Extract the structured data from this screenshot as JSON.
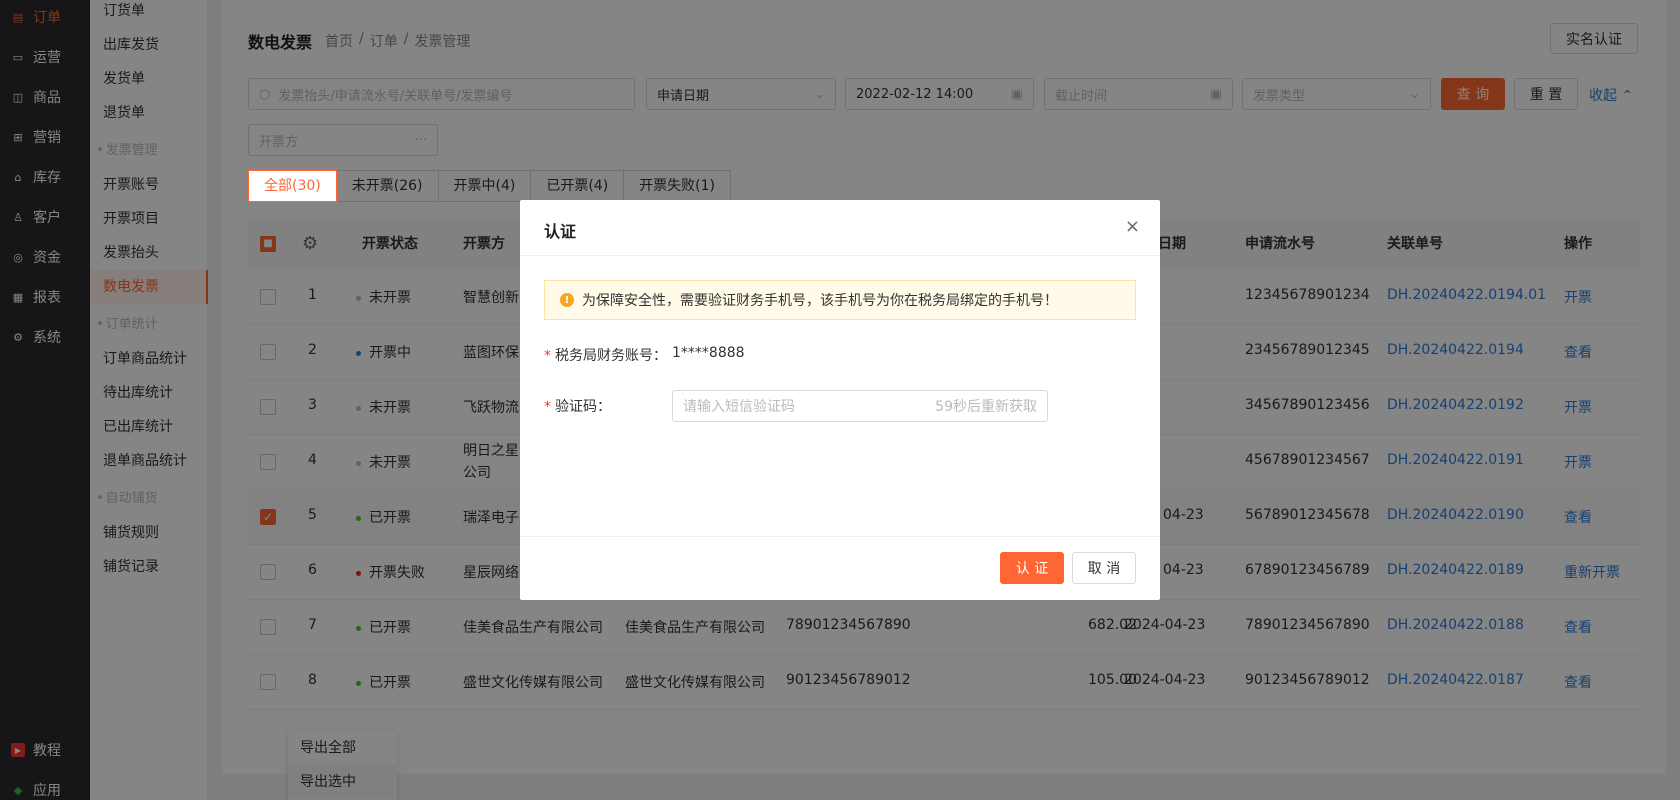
{
  "sidebar": {
    "items": [
      {
        "label": "订单",
        "icon": "order-icon",
        "active": true
      },
      {
        "label": "运营",
        "icon": "operation-icon"
      },
      {
        "label": "商品",
        "icon": "goods-icon"
      },
      {
        "label": "营销",
        "icon": "gift-icon"
      },
      {
        "label": "库存",
        "icon": "warehouse-icon"
      },
      {
        "label": "客户",
        "icon": "user-icon"
      },
      {
        "label": "资金",
        "icon": "money-icon"
      },
      {
        "label": "报表",
        "icon": "chart-icon"
      },
      {
        "label": "系统",
        "icon": "gear-icon"
      }
    ],
    "bottom": [
      {
        "label": "教程",
        "icon": "play-icon"
      },
      {
        "label": "应用",
        "icon": "app-icon"
      }
    ]
  },
  "subnav": {
    "items": [
      "订货单",
      "出库发货",
      "发货单",
      "退货单"
    ],
    "group1": "发票管理",
    "group1_items": [
      "开票账号",
      "开票项目",
      "发票抬头",
      "数电发票"
    ],
    "group2": "订单统计",
    "group2_items": [
      "订单商品统计",
      "待出库统计",
      "已出库统计",
      "退单商品统计"
    ],
    "group3": "自动铺货",
    "group3_items": [
      "铺货规则",
      "铺货记录"
    ]
  },
  "header": {
    "title": "数电发票",
    "breadcrumb": [
      "首页",
      "/",
      "订单",
      "/",
      "发票管理"
    ],
    "realname_btn": "实名认证"
  },
  "filters": {
    "search_placeholder": "发票抬头/申请流水号/关联单号/发票编号",
    "date_type": "申请日期",
    "start_time": "2022-02-12 14:00",
    "end_placeholder": "截止时间",
    "invoice_type_placeholder": "发票类型",
    "query_btn": "查 询",
    "reset_btn": "重 置",
    "collapse_btn": "收起",
    "issuer_placeholder": "开票方"
  },
  "tabs": [
    "全部(30)",
    "未开票(26)",
    "开票中(4)",
    "已开票(4)",
    "开票失败(1)"
  ],
  "table": {
    "headers": [
      "开票状态",
      "开票方",
      "日期",
      "申请流水号",
      "关联单号",
      "操作"
    ],
    "rows": [
      {
        "no": "1",
        "status": "未开票",
        "status_color": "#bbbbbb",
        "issuer": "智慧创新",
        "buyer": "",
        "tax": "",
        "amount": "",
        "date": "",
        "serial": "12345678901234",
        "ref": "DH.20240422.0194.01",
        "action": "开票",
        "checked": false
      },
      {
        "no": "2",
        "status": "开票中",
        "status_color": "#2e7dd6",
        "issuer": "蓝图环保",
        "buyer": "",
        "tax": "",
        "amount": "",
        "date": "",
        "serial": "23456789012345",
        "ref": "DH.20240422.0194",
        "action": "查看",
        "checked": false
      },
      {
        "no": "3",
        "status": "未开票",
        "status_color": "#bbbbbb",
        "issuer": "飞跃物流",
        "buyer": "",
        "tax": "",
        "amount": "",
        "date": "",
        "serial": "34567890123456",
        "ref": "DH.20240422.0192",
        "action": "开票",
        "checked": false
      },
      {
        "no": "4",
        "status": "未开票",
        "status_color": "#bbbbbb",
        "issuer": "明日之星",
        "issuer2": "公司",
        "buyer": "",
        "tax": "",
        "amount": "",
        "date": "",
        "serial": "45678901234567",
        "ref": "DH.20240422.0191",
        "action": "开票",
        "checked": false
      },
      {
        "no": "5",
        "status": "已开票",
        "status_color": "#52c41a",
        "issuer": "瑞泽电子",
        "buyer": "",
        "tax": "",
        "amount": "",
        "date": "04-23",
        "serial": "56789012345678",
        "ref": "DH.20240422.0190",
        "action": "查看",
        "checked": true
      },
      {
        "no": "6",
        "status": "开票失败",
        "status_color": "#f5222d",
        "issuer": "星辰网络",
        "buyer": "",
        "tax": "",
        "amount": "",
        "date": "04-23",
        "serial": "67890123456789",
        "ref": "DH.20240422.0189",
        "action": "重新开票",
        "checked": false
      },
      {
        "no": "7",
        "status": "已开票",
        "status_color": "#52c41a",
        "issuer": "佳美食品生产有限公司",
        "buyer": "佳美食品生产有限公司",
        "tax": "78901234567890",
        "amount": "682.02",
        "date": "2024-04-23",
        "serial": "78901234567890",
        "ref": "DH.20240422.0188",
        "action": "查看",
        "checked": false
      },
      {
        "no": "8",
        "status": "已开票",
        "status_color": "#52c41a",
        "issuer": "盛世文化传媒有限公司",
        "buyer": "盛世文化传媒有限公司",
        "tax": "90123456789012",
        "amount": "105.00",
        "date": "2024-04-23",
        "serial": "90123456789012",
        "ref": "DH.20240422.0187",
        "action": "查看",
        "checked": false
      }
    ]
  },
  "export_menu": [
    "导出全部",
    "导出选中"
  ],
  "modal": {
    "title": "认证",
    "alert": "为保障安全性，需要验证财务手机号，该手机号为你在税务局绑定的手机号！",
    "account_label": "税务局财务账号：",
    "account_value": "1****8888",
    "code_label": "验证码：",
    "code_placeholder": "请输入短信验证码",
    "resend": "59秒后重新获取",
    "confirm": "认 证",
    "cancel": "取 消"
  },
  "colors": {
    "accent": "#ff6633",
    "link": "#2e7dd6",
    "sidebar_bg": "#2b2b30"
  }
}
